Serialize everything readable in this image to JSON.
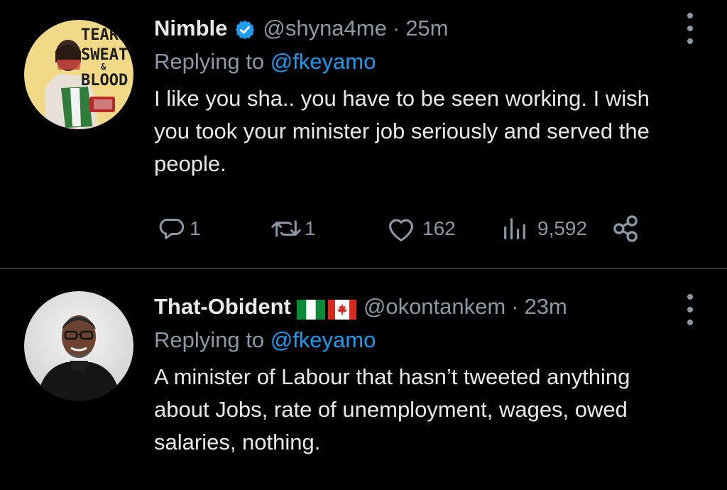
{
  "tweets": [
    {
      "display_name": "Nimble",
      "handle": "@shyna4me",
      "separator": "·",
      "time": "25m",
      "reply_prefix": "Replying to",
      "reply_to": "@fkeyamo",
      "text": "I like you sha.. you have to be seen working. I wish you took your minister job seriously and served the people.",
      "avatar_text": [
        "TEARS",
        "SWEAT",
        "&",
        "BLOOD"
      ],
      "metrics": {
        "replies": "1",
        "retweets": "1",
        "likes": "162",
        "views": "9,592"
      }
    },
    {
      "display_name": "That-Obident",
      "flags": [
        "nigeria-flag",
        "canada-flag"
      ],
      "handle": "@okontankem",
      "separator": "·",
      "time": "23m",
      "reply_prefix": "Replying to",
      "reply_to": "@fkeyamo",
      "text": "A minister of Labour that hasn’t tweeted anything about Jobs, rate of unemployment, wages, owed salaries, nothing."
    }
  ],
  "colors": {
    "background": "#000000",
    "primary_text": "#e7e9ea",
    "secondary_text": "#8b98a5",
    "link": "#1d9bf0",
    "divider": "#2f3336"
  },
  "icons": [
    "verified-badge-icon",
    "more-options-icon",
    "reply-icon",
    "retweet-icon",
    "like-icon",
    "views-icon",
    "share-icon"
  ]
}
